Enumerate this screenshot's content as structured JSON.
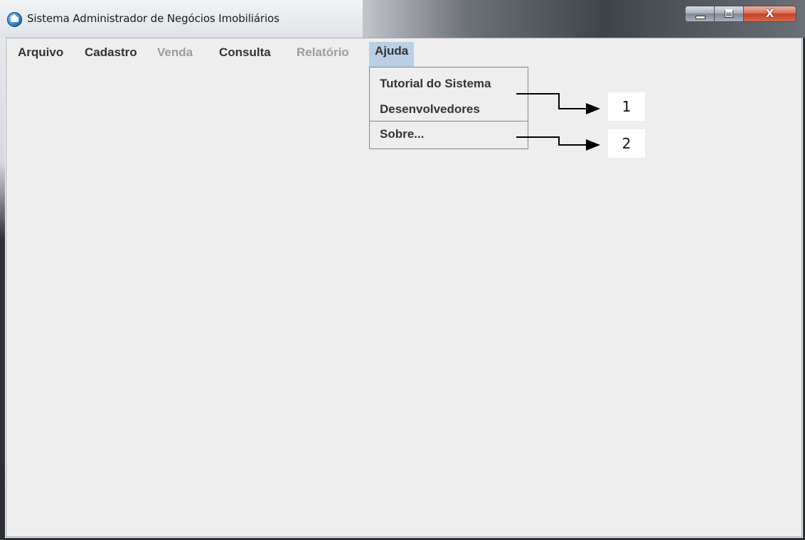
{
  "window": {
    "title": "Sistema Administrador de Negócios Imobiliários",
    "close_glyph": "X",
    "icon": "house-globe-icon"
  },
  "menubar": {
    "items": [
      {
        "label": "Arquivo",
        "enabled": true
      },
      {
        "label": "Cadastro",
        "enabled": true
      },
      {
        "label": "Venda",
        "enabled": false
      },
      {
        "label": "Consulta",
        "enabled": true
      },
      {
        "label": "Relatório",
        "enabled": false
      },
      {
        "label": "Ajuda",
        "enabled": true,
        "open": true
      }
    ]
  },
  "ajuda_menu": {
    "items": [
      {
        "label": "Tutorial do Sistema"
      },
      {
        "label": "Desenvolvedores"
      },
      {
        "label": "Sobre..."
      }
    ]
  },
  "annotations": {
    "callout_1": "1",
    "callout_2": "2"
  },
  "colors": {
    "menu_highlight": "#b8cfe5",
    "disabled_text": "#9c9c9c",
    "client_bg": "#eeeeee"
  }
}
